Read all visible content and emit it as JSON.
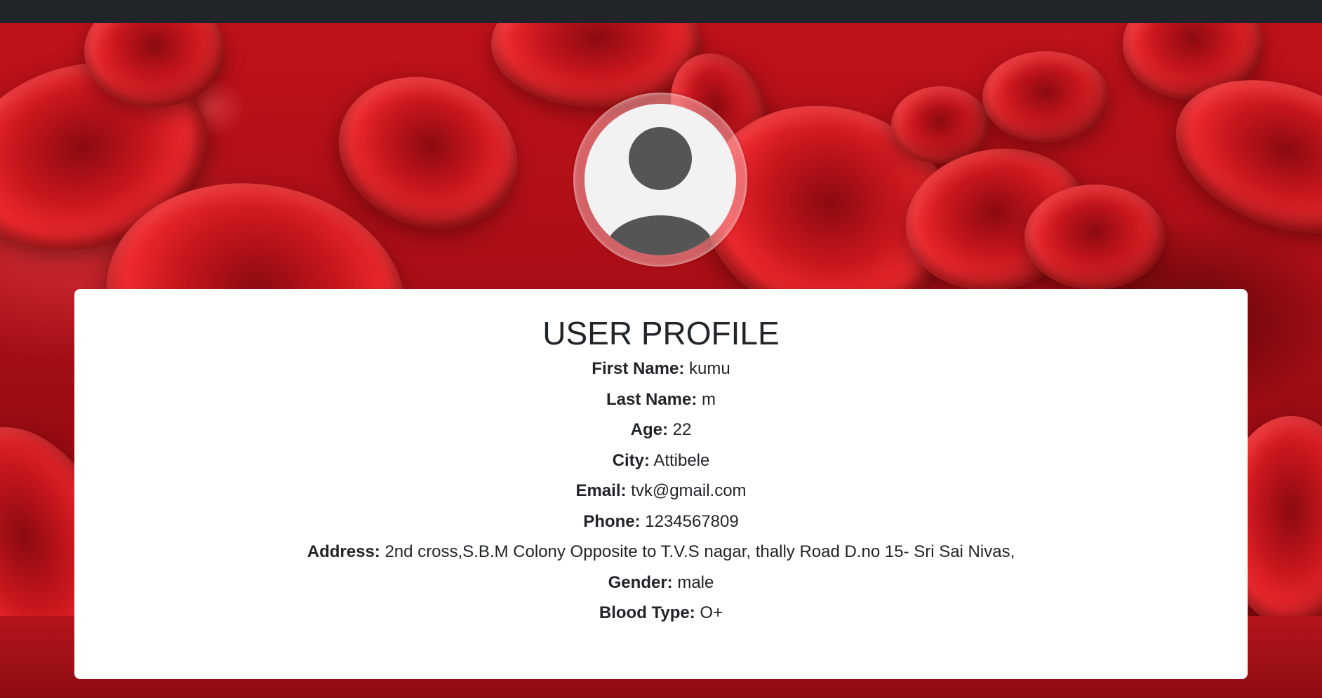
{
  "profile": {
    "title": "USER PROFILE",
    "fields": [
      {
        "label": "First Name:",
        "value": "kumu"
      },
      {
        "label": "Last Name:",
        "value": "m"
      },
      {
        "label": "Age:",
        "value": "22"
      },
      {
        "label": "City:",
        "value": "Attibele"
      },
      {
        "label": "Email:",
        "value": "tvk@gmail.com"
      },
      {
        "label": "Phone:",
        "value": "1234567809"
      },
      {
        "label": "Address:",
        "value": "2nd cross,S.B.M Colony Opposite to T.V.S nagar, thally Road D.no 15- Sri Sai Nivas,"
      },
      {
        "label": "Gender:",
        "value": "male"
      },
      {
        "label": "Blood Type:",
        "value": "O+"
      }
    ]
  },
  "avatar": {
    "icon": "user-avatar-icon"
  },
  "colors": {
    "navbar": "#212529",
    "card": "#ffffff",
    "text": "#212529",
    "avatar_bg": "#f2f2f2",
    "avatar_figure": "#555555",
    "background_red": "#c0121a"
  }
}
